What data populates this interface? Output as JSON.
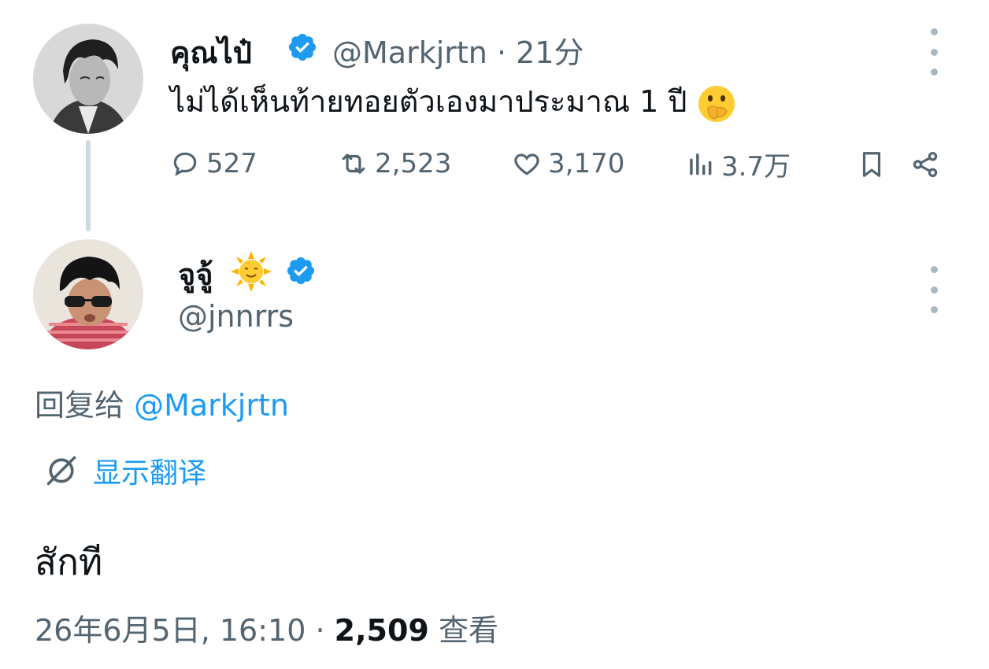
{
  "tweet": {
    "author_name": "คุณไป๋",
    "author_handle": "@Markjrtn",
    "separator": "·",
    "time_ago": "21分",
    "text": "ไม่ได้เห็นท้ายทอยตัวเองมาประมาณ 1 ปี",
    "emoji": "face-with-hand-over-mouth",
    "actions": {
      "replies": "527",
      "retweets": "2,523",
      "likes": "3,170",
      "views": "3.7万"
    }
  },
  "reply": {
    "author_name": "จูจู้",
    "name_emoji": "sun-with-face",
    "author_handle": "@jnnrrs",
    "reply_to_label": "回复给",
    "reply_to_handle": "@Markjrtn",
    "translate_label": "显示翻译",
    "text": "สักที",
    "timestamp": "26年6月5日, 16:10",
    "separator": "·",
    "view_count": "2,509",
    "view_label": "查看"
  },
  "colors": {
    "accent": "#1d9bf0",
    "secondary_text": "#536471",
    "primary_text": "#0f1419",
    "thread_line": "#cfd9de"
  }
}
